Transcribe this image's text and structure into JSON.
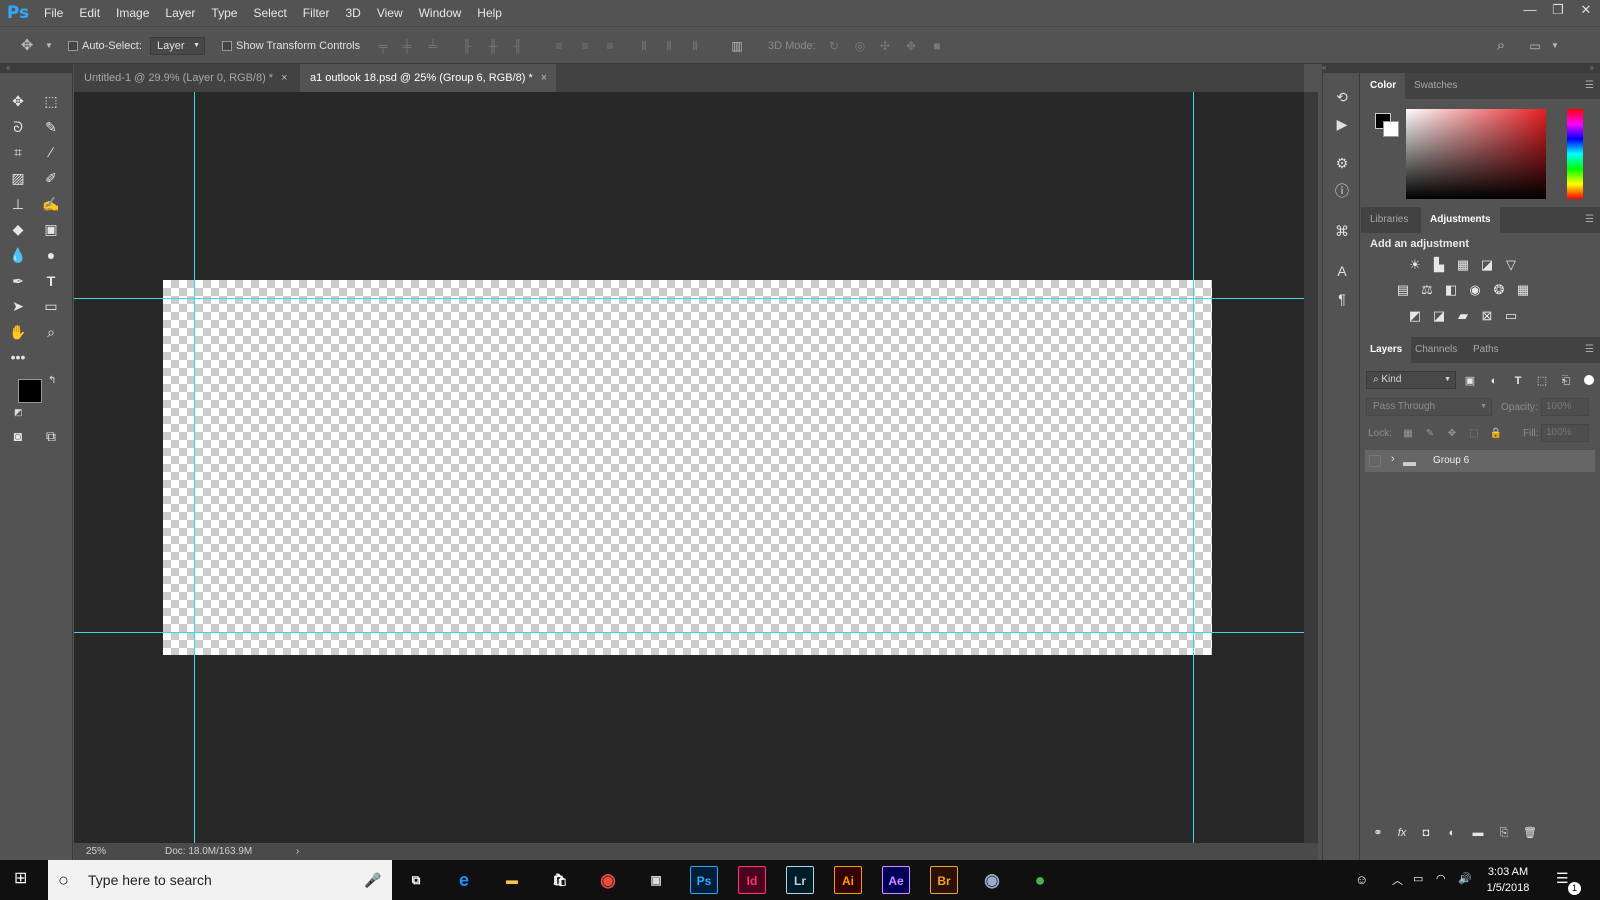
{
  "app": {
    "logo": "Ps",
    "accent": "#31a8ff"
  },
  "menu": [
    "File",
    "Edit",
    "Image",
    "Layer",
    "Type",
    "Select",
    "Filter",
    "3D",
    "View",
    "Window",
    "Help"
  ],
  "window_controls": {
    "minimize": "—",
    "restore": "❐",
    "close": "✕"
  },
  "options": {
    "auto_select_label": "Auto-Select:",
    "auto_select_target": "Layer",
    "show_transform_label": "Show Transform Controls",
    "mode_3d_label": "3D Mode:"
  },
  "tabs": [
    {
      "label": "Untitled-1 @ 29.9% (Layer 0, RGB/8) *",
      "active": false
    },
    {
      "label": "a1 outlook 18.psd @ 25% (Group 6, RGB/8) *",
      "active": true
    }
  ],
  "tab_close": "×",
  "status": {
    "zoom": "25%",
    "doc": "Doc: 18.0M/163.9M",
    "arrow": "›"
  },
  "color_panel": {
    "tabs": [
      "Color",
      "Swatches"
    ],
    "active": "Color"
  },
  "adjustments_panel": {
    "tabs": [
      "Libraries",
      "Adjustments"
    ],
    "active": "Adjustments",
    "heading": "Add an adjustment"
  },
  "layers_panel": {
    "tabs": [
      "Layers",
      "Channels",
      "Paths"
    ],
    "active": "Layers",
    "filter_kind": "Kind",
    "blend_mode": "Pass Through",
    "opacity_label": "Opacity:",
    "opacity_value": "100%",
    "lock_label": "Lock:",
    "fill_label": "Fill:",
    "fill_value": "100%",
    "layers": [
      {
        "name": "Group 6",
        "type": "group"
      }
    ]
  },
  "taskbar": {
    "search_placeholder": "Type here to search",
    "apps": [
      {
        "name": "Id",
        "color": "#ff3366"
      },
      {
        "name": "Lr",
        "color": "#add5ec"
      },
      {
        "name": "Ai",
        "color": "#ff9a00"
      },
      {
        "name": "Ae",
        "color": "#d291ff"
      },
      {
        "name": "Br",
        "color": "#e8a435"
      }
    ],
    "running_app": "Ps",
    "time": "3:03 AM",
    "date": "1/5/2018",
    "notification_count": "1"
  }
}
